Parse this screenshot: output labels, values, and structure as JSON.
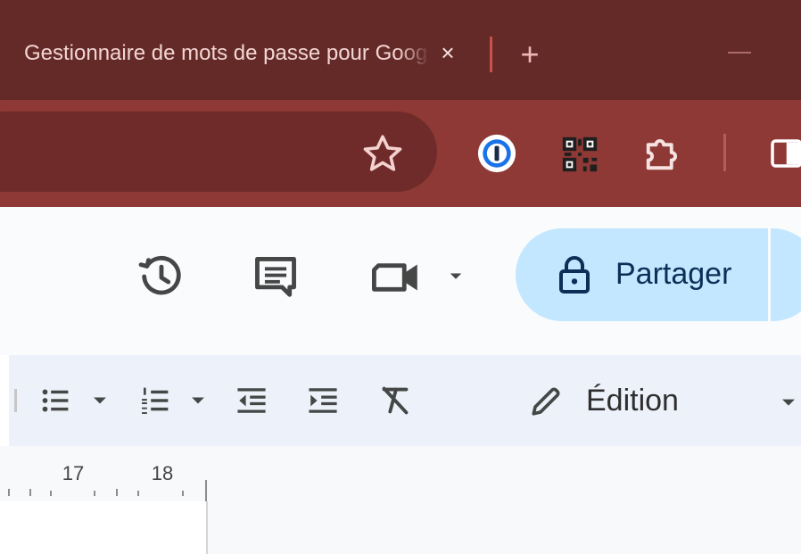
{
  "browser": {
    "tab_title": "Gestionnaire de mots de passe pour Google Docs",
    "tab_close": "×",
    "new_tab": "+",
    "colors": {
      "frame": "#642a28",
      "toolbar": "#8e3936",
      "omnibox": "#6f2b29"
    }
  },
  "toolbar_icons": [
    "star-icon",
    "password-manager-icon",
    "qr-code-icon",
    "puzzle-extensions-icon",
    "side-panel-icon"
  ],
  "docs_header": {
    "icons": [
      "history-icon",
      "comment-icon",
      "meet-icon"
    ],
    "share_label": "Partager",
    "share_color": "#c2e7ff"
  },
  "format_bar": {
    "icons": [
      "bulleted-list-icon",
      "numbered-list-icon",
      "decrease-indent-icon",
      "increase-indent-icon",
      "clear-formatting-icon",
      "pencil-icon"
    ],
    "mode_label": "Édition"
  },
  "ruler": {
    "labels": [
      "17",
      "18"
    ]
  }
}
